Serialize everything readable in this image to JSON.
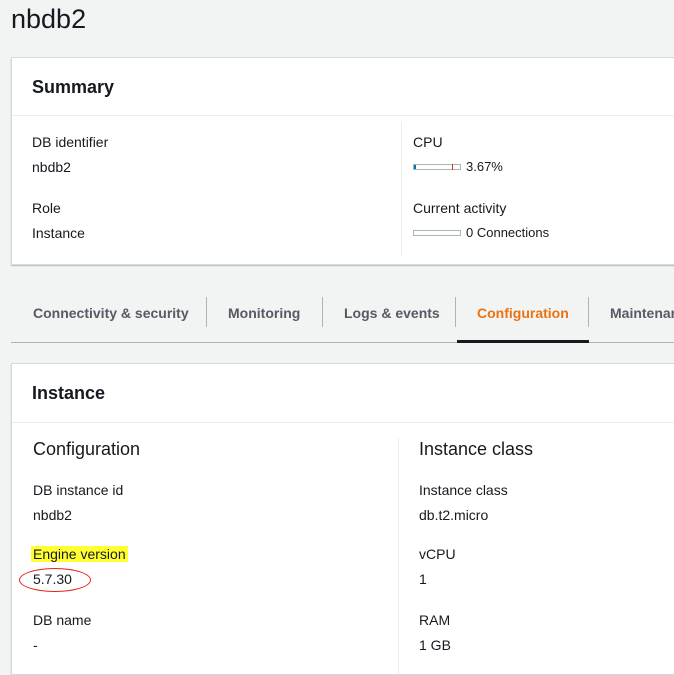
{
  "page": {
    "title": "nbdb2"
  },
  "summary": {
    "title": "Summary",
    "db_identifier_label": "DB identifier",
    "db_identifier_value": "nbdb2",
    "role_label": "Role",
    "role_value": "Instance",
    "cpu_label": "CPU",
    "cpu_value": "3.67%",
    "cpu_fraction": 0.0367,
    "activity_label": "Current activity",
    "activity_value": "0 Connections",
    "activity_fraction": 0
  },
  "tabs": [
    {
      "label": "Connectivity & security",
      "active": false
    },
    {
      "label": "Monitoring",
      "active": false
    },
    {
      "label": "Logs & events",
      "active": false
    },
    {
      "label": "Configuration",
      "active": true
    },
    {
      "label": "Maintenar",
      "active": false
    }
  ],
  "instance": {
    "title": "Instance",
    "configuration": {
      "title": "Configuration",
      "db_instance_id_label": "DB instance id",
      "db_instance_id_value": "nbdb2",
      "engine_version_label": "Engine version",
      "engine_version_value": "5.7.30",
      "db_name_label": "DB name",
      "db_name_value": "-"
    },
    "instance_class": {
      "title": "Instance class",
      "instance_class_label": "Instance class",
      "instance_class_value": "db.t2.micro",
      "vcpu_label": "vCPU",
      "vcpu_value": "1",
      "ram_label": "RAM",
      "ram_value": "1 GB"
    }
  },
  "colors": {
    "accent": "#ec7211",
    "highlight": "#ffff33",
    "annotation": "#e0231a"
  }
}
